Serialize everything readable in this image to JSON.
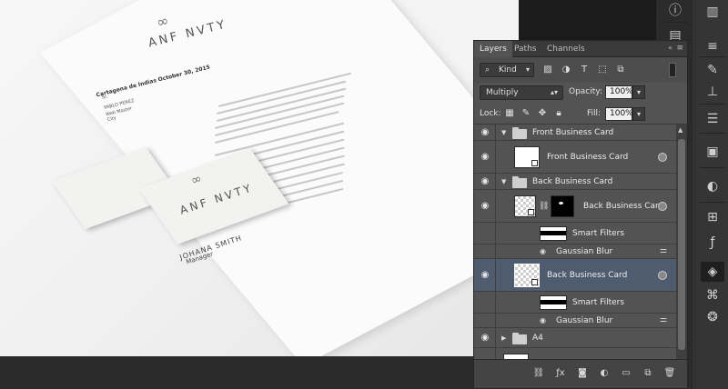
{
  "canvas": {
    "logo_mark": "∞",
    "logo_text": "ANF NVTY",
    "date": "Cartagena de Indias October 30, 2015",
    "address": [
      "Sr.",
      "PABLO PEREZ",
      "Web Master",
      "City"
    ],
    "card_name": "JOHANA SMITH",
    "card_role": "Manager"
  },
  "panel": {
    "tabs": [
      "Layers",
      "Paths",
      "Channels"
    ],
    "active_tab": "Layers",
    "tab_arrows": "«",
    "tab_menu": "≡",
    "kind_label": "Kind",
    "blend_mode": "Multiply",
    "opacity_label": "Opacity:",
    "opacity_value": "100%",
    "lock_label": "Lock:",
    "fill_label": "Fill:",
    "fill_value": "100%",
    "layers": [
      {
        "name": "Front Business Card",
        "type": "group"
      },
      {
        "name": "Front Business Card",
        "type": "smart"
      },
      {
        "name": "Back Business Card",
        "type": "group"
      },
      {
        "name": "Back Business Card",
        "type": "smart-mask"
      },
      {
        "name": "Smart Filters",
        "type": "filters"
      },
      {
        "name": "Gaussian Blur",
        "type": "filter"
      },
      {
        "name": "Back Business Card",
        "type": "smart",
        "selected": true
      },
      {
        "name": "Smart Filters",
        "type": "filters"
      },
      {
        "name": "Gaussian Blur",
        "type": "filter"
      },
      {
        "name": "A4",
        "type": "group"
      }
    ]
  },
  "toolbar": {
    "icons": [
      "info-icon",
      "document-icon",
      "histogram-icon",
      "color-icon",
      "adjustments-icon",
      "brush-icon",
      "stamp-icon",
      "notes-icon",
      "navigator-icon",
      "properties-icon",
      "fx-icon",
      "layers-icon",
      "paths-icon",
      "channels-icon"
    ]
  },
  "colors": {
    "panel_bg": "#535353",
    "selected_layer": "#4f5c70",
    "toolbar_bg": "#323232"
  }
}
